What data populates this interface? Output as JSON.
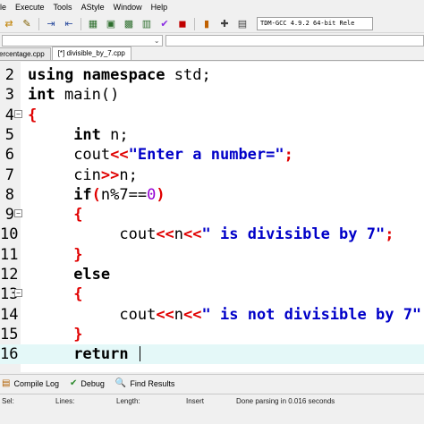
{
  "menubar": {
    "items": [
      "le",
      "Execute",
      "Tools",
      "AStyle",
      "Window",
      "Help"
    ]
  },
  "toolbar": {
    "compiler": "TDM-GCC 4.9.2 64-bit Rele"
  },
  "tabs": [
    {
      "label": "ercentage.cpp",
      "active": false
    },
    {
      "label": "[*] divisible_by_7.cpp",
      "active": true
    }
  ],
  "editor": {
    "lines": [
      {
        "number": "2",
        "fold": "",
        "current": false
      },
      {
        "number": "3",
        "fold": "",
        "current": false
      },
      {
        "number": "4",
        "fold": "−",
        "current": false
      },
      {
        "number": "5",
        "fold": "",
        "current": false
      },
      {
        "number": "6",
        "fold": "",
        "current": false
      },
      {
        "number": "7",
        "fold": "",
        "current": false
      },
      {
        "number": "8",
        "fold": "",
        "current": false
      },
      {
        "number": "9",
        "fold": "−",
        "current": false
      },
      {
        "number": "10",
        "fold": "",
        "current": false
      },
      {
        "number": "11",
        "fold": "",
        "current": false
      },
      {
        "number": "12",
        "fold": "",
        "current": false
      },
      {
        "number": "13",
        "fold": "−",
        "current": false
      },
      {
        "number": "14",
        "fold": "",
        "current": false
      },
      {
        "number": "15",
        "fold": "",
        "current": false
      },
      {
        "number": "16",
        "fold": "",
        "current": true
      }
    ],
    "code": {
      "l2_kw": "using namespace",
      "l2_rest": " std;",
      "l3_kw": "int",
      "l3_rest": " main()",
      "l4": "{",
      "l5_kw": "int",
      "l5_rest": " n;",
      "l6_a": "cout",
      "l6_op": "<<",
      "l6_str": "\"Enter a number=\"",
      "l6_end": ";",
      "l7_a": "cin",
      "l7_op": ">>",
      "l7_b": "n;",
      "l8_kw": "if",
      "l8_p1": "(",
      "l8_b": "n%7==",
      "l8_num": "0",
      "l8_p2": ")",
      "l9": "{",
      "l10_a": "cout",
      "l10_op1": "<<",
      "l10_b": "n",
      "l10_op2": "<<",
      "l10_str": "\" is divisible by 7\"",
      "l10_end": ";",
      "l11": "}",
      "l12_kw": "else",
      "l13": "{",
      "l14_a": "cout",
      "l14_op1": "<<",
      "l14_b": "n",
      "l14_op2": "<<",
      "l14_str": "\" is not divisible by 7\"",
      "l14_end": ";",
      "l15": "}",
      "l16_kw": "return"
    }
  },
  "bottom_tabs": [
    {
      "icon": "compile-log-icon",
      "glyph": "▤",
      "label": "Compile Log"
    },
    {
      "icon": "debug-icon",
      "glyph": "✔",
      "label": "Debug"
    },
    {
      "icon": "find-results-icon",
      "glyph": "🔍",
      "label": "Find Results"
    }
  ],
  "statusbar": {
    "sel": "Sel:",
    "lines": "Lines:",
    "length": "Length:",
    "mode": "Insert",
    "message": "Done parsing in 0.016 seconds"
  },
  "colors": {
    "keyword": "#000000",
    "operator": "#e00000",
    "string": "#0000c8",
    "number": "#9400d3",
    "current_line": "#e4f8f8"
  }
}
